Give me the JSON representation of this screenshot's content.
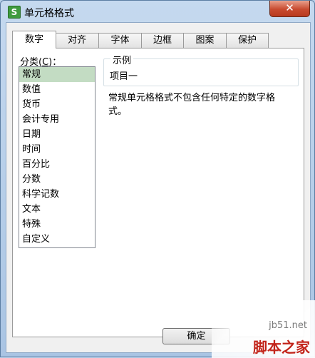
{
  "window": {
    "title": "单元格格式",
    "app_icon": "S",
    "close_glyph": "✕"
  },
  "tabs": [
    {
      "label": "数字",
      "active": true
    },
    {
      "label": "对齐"
    },
    {
      "label": "字体"
    },
    {
      "label": "边框"
    },
    {
      "label": "图案"
    },
    {
      "label": "保护"
    }
  ],
  "category": {
    "label_prefix": "分类(",
    "label_accel": "C",
    "label_suffix": ")：",
    "items": [
      "常规",
      "数值",
      "货币",
      "会计专用",
      "日期",
      "时间",
      "百分比",
      "分数",
      "科学记数",
      "文本",
      "特殊",
      "自定义"
    ],
    "selected": "常规"
  },
  "sample": {
    "legend": "示例",
    "value": "项目一"
  },
  "description": "常规单元格格式不包含任何特定的数字格式。",
  "buttons": {
    "ok": "确定"
  },
  "watermark": {
    "domain": "jb51.net",
    "text": "脚本之家"
  },
  "colors": {
    "selection": "#c3dcc3",
    "close_button": "#c84a2f"
  }
}
